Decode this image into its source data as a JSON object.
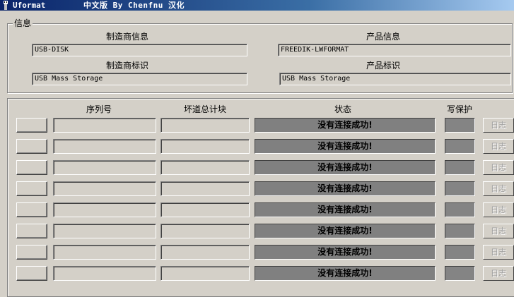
{
  "window": {
    "title_app": "Uformat",
    "title_credit": "中文版 By Chenfnu 汉化"
  },
  "info_group": {
    "caption": "信息",
    "vendor_info": {
      "label": "制造商信息",
      "value": "USB-DISK"
    },
    "product_info": {
      "label": "产品信息",
      "value": "FREEDIK-LWFORMAT"
    },
    "vendor_id": {
      "label": "制造商标识",
      "value": "USB Mass Storage"
    },
    "product_id": {
      "label": "产品标识",
      "value": "USB Mass Storage"
    }
  },
  "device_table": {
    "columns": {
      "serial": "序列号",
      "bad_blocks": "坏道总计块",
      "status": "状态",
      "write_protect": "写保护"
    },
    "rows": [
      {
        "serial": "",
        "bad_blocks": "",
        "status": "没有连接成功!",
        "log": "日志"
      },
      {
        "serial": "",
        "bad_blocks": "",
        "status": "没有连接成功!",
        "log": "日志"
      },
      {
        "serial": "",
        "bad_blocks": "",
        "status": "没有连接成功!",
        "log": "日志"
      },
      {
        "serial": "",
        "bad_blocks": "",
        "status": "没有连接成功!",
        "log": "日志"
      },
      {
        "serial": "",
        "bad_blocks": "",
        "status": "没有连接成功!",
        "log": "日志"
      },
      {
        "serial": "",
        "bad_blocks": "",
        "status": "没有连接成功!",
        "log": "日志"
      },
      {
        "serial": "",
        "bad_blocks": "",
        "status": "没有连接成功!",
        "log": "日志"
      },
      {
        "serial": "",
        "bad_blocks": "",
        "status": "没有连接成功!",
        "log": "日志"
      }
    ]
  },
  "colors": {
    "face": "#d4d0c8",
    "status_bg": "#808080",
    "title_bar": "#0a246a"
  }
}
